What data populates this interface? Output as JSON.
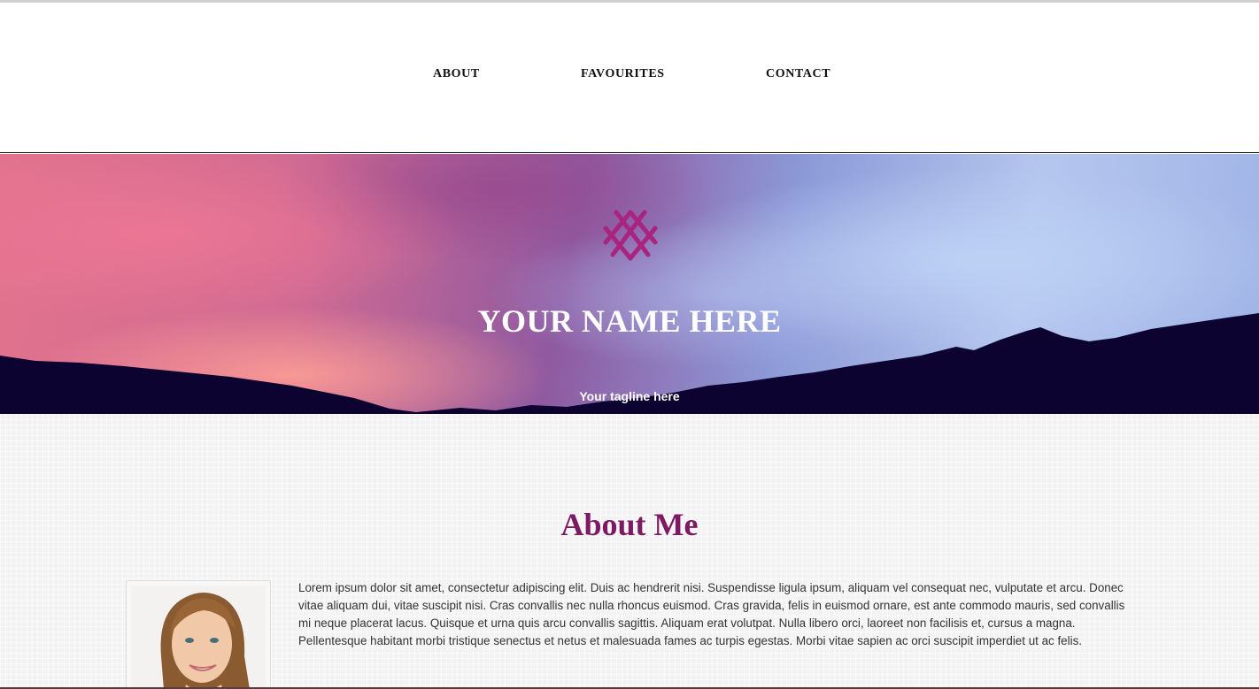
{
  "nav": {
    "items": [
      {
        "label": "ABOUT"
      },
      {
        "label": "FAVOURITES"
      },
      {
        "label": "CONTACT"
      }
    ]
  },
  "hero": {
    "logo_icon": "crosshatch-logo-icon",
    "logo_color": "#a8247f",
    "title": "YOUR NAME HERE",
    "tagline": "Your tagline here"
  },
  "about": {
    "heading": "About Me",
    "heading_color": "#7e1a63",
    "photo_icon": "profile-photo",
    "body": "Lorem ipsum dolor sit amet, consectetur adipiscing elit. Duis ac hendrerit nisi. Suspendisse ligula ipsum, aliquam vel consequat nec, vulputate et arcu. Donec vitae aliquam dui, vitae suscipit nisi. Cras convallis nec nulla rhoncus euismod. Cras gravida, felis in euismod ornare, est ante commodo mauris, sed convallis mi neque placerat lacus. Quisque et urna quis arcu convallis sagittis. Aliquam erat volutpat. Nulla libero orci, laoreet non facilisis et, cursus a magna. Pellentesque habitant morbi tristique senectus et netus et malesuada fames ac turpis egestas. Morbi vitae sapien ac orci suscipit imperdiet ut ac felis."
  }
}
